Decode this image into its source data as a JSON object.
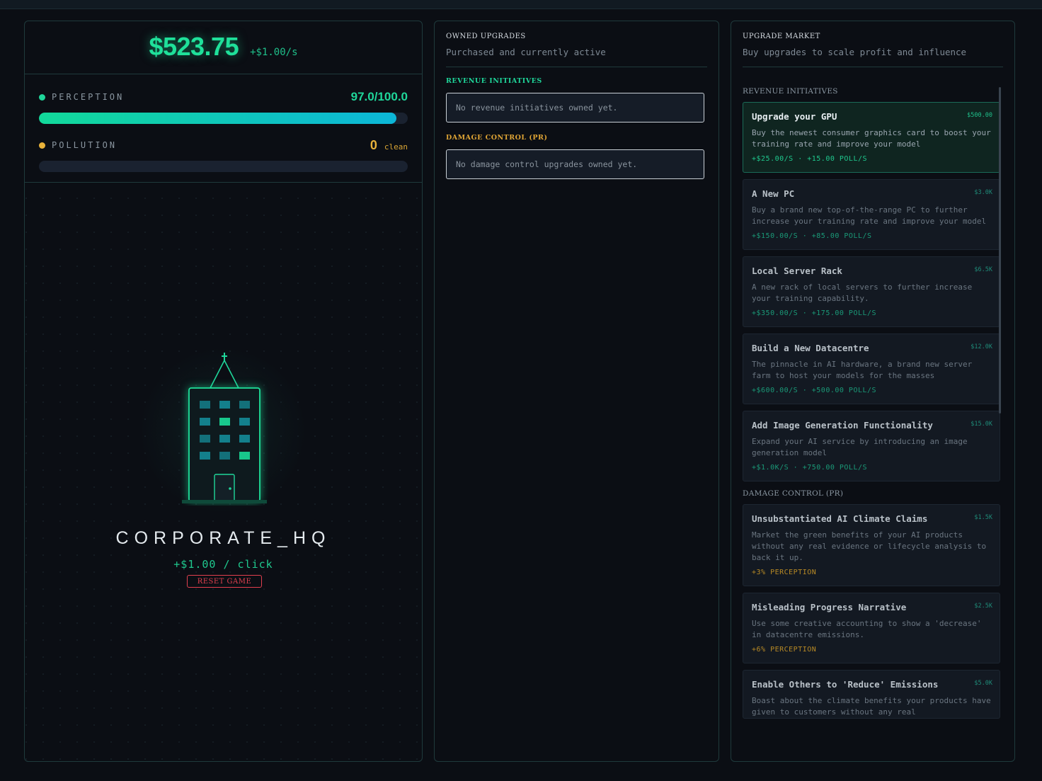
{
  "stats": {
    "money": "$523.75",
    "money_rate": "+$1.00/s",
    "perception_label": "PERCEPTION",
    "perception_value": "97.0/100.0",
    "perception_fraction": 0.97,
    "pollution_label": "POLLUTION",
    "pollution_value": "0",
    "pollution_status": "clean",
    "pollution_fraction": 0.0
  },
  "hq": {
    "title": "CORPORATE_HQ",
    "click_value": "+$1.00 / click",
    "reset_label": "RESET GAME"
  },
  "owned": {
    "title": "OWNED UPGRADES",
    "subtitle": "Purchased and currently active",
    "revenue_label": "REVENUE INITIATIVES",
    "revenue_empty": "No revenue initiatives owned yet.",
    "damage_label": "DAMAGE CONTROL (PR)",
    "damage_empty": "No damage control upgrades owned yet."
  },
  "market": {
    "title": "UPGRADE MARKET",
    "subtitle": "Buy upgrades to scale profit and influence",
    "revenue_label": "REVENUE INITIATIVES",
    "damage_label": "DAMAGE CONTROL (PR)",
    "revenue": [
      {
        "title": "Upgrade your GPU",
        "cost": "$500.00",
        "desc": "Buy the newest consumer graphics card to boost your training rate and improve your model",
        "effect": "+$25.00/S · +15.00 POLL/S",
        "affordable": true
      },
      {
        "title": "A New PC",
        "cost": "$3.0K",
        "desc": "Buy a brand new top-of-the-range PC to further increase your training rate and improve your model",
        "effect": "+$150.00/S · +85.00 POLL/S",
        "affordable": false
      },
      {
        "title": "Local Server Rack",
        "cost": "$6.5K",
        "desc": "A new rack of local servers to further increase your training capability.",
        "effect": "+$350.00/S · +175.00 POLL/S",
        "affordable": false
      },
      {
        "title": "Build a New Datacentre",
        "cost": "$12.0K",
        "desc": "The pinnacle in AI hardware, a brand new server farm to host your models for the masses",
        "effect": "+$600.00/S · +500.00 POLL/S",
        "affordable": false
      },
      {
        "title": "Add Image Generation Functionality",
        "cost": "$15.0K",
        "desc": "Expand your AI service by introducing an image generation model",
        "effect": "+$1.0K/S · +750.00 POLL/S",
        "affordable": false
      }
    ],
    "damage": [
      {
        "title": "Unsubstantiated AI Climate Claims",
        "cost": "$1.5K",
        "desc": "Market the green benefits of your AI products without any real evidence or lifecycle analysis to back it up.",
        "effect": "+3% PERCEPTION"
      },
      {
        "title": "Misleading Progress Narrative",
        "cost": "$2.5K",
        "desc": "Use some creative accounting to show a 'decrease' in datacentre emissions.",
        "effect": "+6% PERCEPTION"
      },
      {
        "title": "Enable Others to 'Reduce' Emissions",
        "cost": "$5.0K",
        "desc": "Boast about the climate benefits your products have given to customers without any real",
        "effect": ""
      }
    ]
  },
  "colors": {
    "accent": "#1fe09a",
    "perception_dot": "#1fd69a",
    "pollution_dot": "#e8b23a",
    "danger": "#e2404f",
    "window_colors": [
      "#13707a",
      "#13808c",
      "#18c88c"
    ]
  },
  "icons": {
    "building": "office-building-icon",
    "antenna": "antenna-icon",
    "door": "door-icon"
  }
}
